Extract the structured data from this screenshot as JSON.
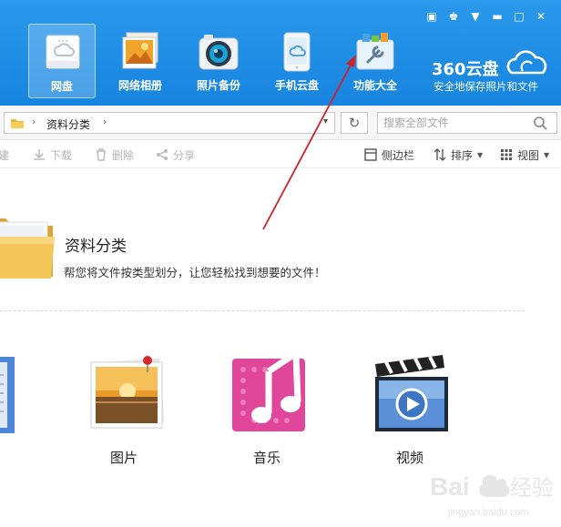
{
  "nav": {
    "items": [
      {
        "label": "网盘",
        "icon": "cloud-disk-icon",
        "active": true
      },
      {
        "label": "网络相册",
        "icon": "photo-album-icon",
        "active": false
      },
      {
        "label": "照片备份",
        "icon": "camera-icon",
        "active": false
      },
      {
        "label": "手机云盘",
        "icon": "phone-cloud-icon",
        "active": false
      },
      {
        "label": "功能大全",
        "icon": "toolbox-icon",
        "active": false
      }
    ]
  },
  "brand": {
    "name": "360云盘",
    "slogan": "安全地保存照片和文件"
  },
  "window_controls": [
    "feedback-icon",
    "skin-icon",
    "menu-icon",
    "minimize-icon",
    "maximize-icon",
    "close-icon"
  ],
  "address": {
    "crumb": "资料分类"
  },
  "search": {
    "placeholder": "搜索全部文件"
  },
  "toolbar": {
    "new_label": "建",
    "download_label": "下载",
    "delete_label": "删除",
    "share_label": "分享",
    "sidebar_label": "侧边栏",
    "sort_label": "排序",
    "view_label": "视图"
  },
  "section": {
    "title": "资料分类",
    "description": "帮您将文件按类型划分，让您轻松找到想要的文件！"
  },
  "categories": [
    {
      "label": "图片",
      "icon": "picture-icon"
    },
    {
      "label": "音乐",
      "icon": "music-icon"
    },
    {
      "label": "视频",
      "icon": "video-icon"
    }
  ],
  "colors": {
    "header_blue": "#1f8fe6",
    "annotation_red": "#d0202a",
    "music_pink": "#e0479a"
  }
}
